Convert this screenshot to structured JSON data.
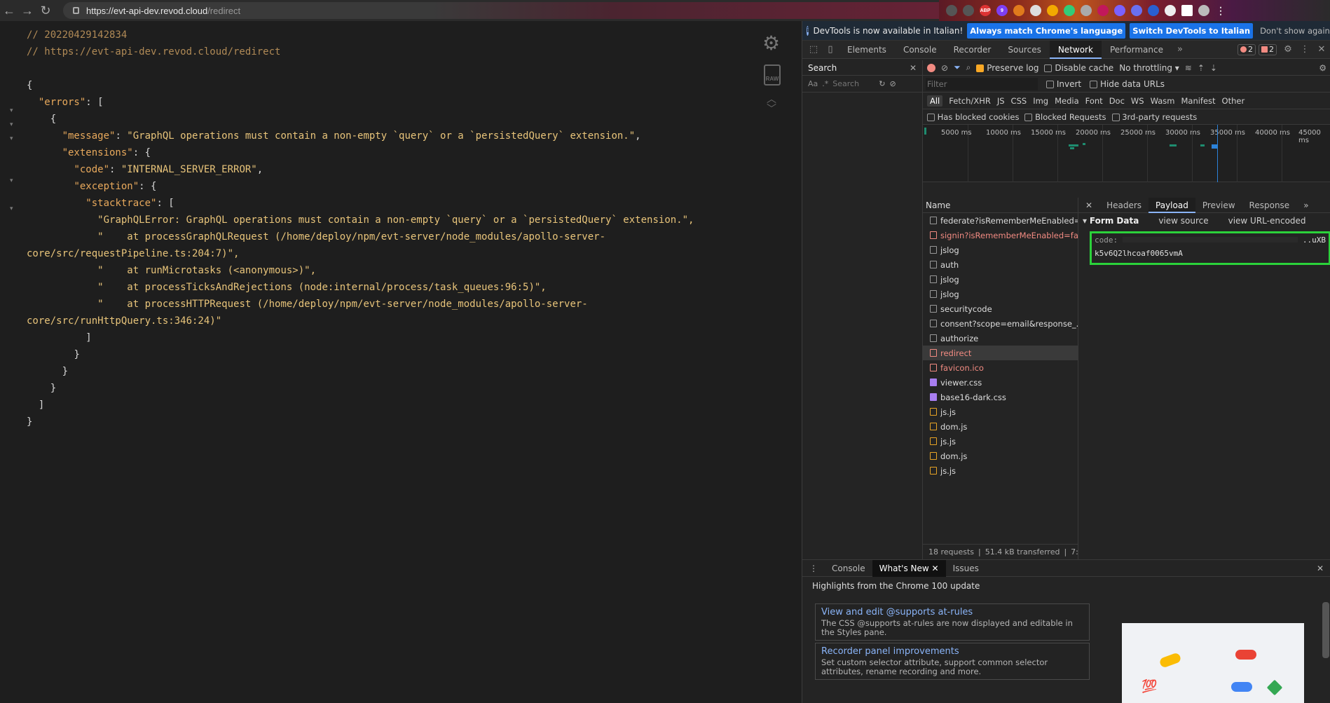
{
  "browser": {
    "url_host": "https://evt-api-dev.revod.cloud",
    "url_path": "/redirect",
    "extensions": [
      "ABP",
      "9"
    ]
  },
  "viewer": {
    "comment1": "// 20220429142834",
    "comment2": "// https://evt-api-dev.revod.cloud/redirect",
    "json": {
      "errors_key": "\"errors\"",
      "message_key": "\"message\"",
      "message_value": "\"GraphQL operations must contain a non-empty `query` or a `persistedQuery` extension.\"",
      "extensions_key": "\"extensions\"",
      "code_key": "\"code\"",
      "code_value": "\"INTERNAL_SERVER_ERROR\"",
      "exception_key": "\"exception\"",
      "stacktrace_key": "\"stacktrace\"",
      "stack": [
        "\"GraphQLError: GraphQL operations must contain a non-empty `query` or a `persistedQuery` extension.\",",
        "\"    at processGraphQLRequest (/home/deploy/npm/evt-server/node_modules/apollo-server-",
        "core/src/requestPipeline.ts:204:7)\",",
        "\"    at runMicrotasks (<anonymous>)\",",
        "\"    at processTicksAndRejections (node:internal/process/task_queues:96:5)\",",
        "\"    at processHTTPRequest (/home/deploy/npm/evt-server/node_modules/apollo-server-",
        "core/src/runHttpQuery.ts:346:24)\""
      ]
    },
    "raw_label": "RAW"
  },
  "devtools": {
    "infobar": {
      "message": "DevTools is now available in Italian!",
      "btn_match": "Always match Chrome's language",
      "btn_switch": "Switch DevTools to Italian",
      "btn_dismiss": "Don't show again"
    },
    "tabs": [
      "Elements",
      "Console",
      "Recorder",
      "Sources",
      "Network",
      "Performance"
    ],
    "active_tab": "Network",
    "errors_count": "2",
    "issues_count": "2",
    "search": {
      "title": "Search",
      "aa": "Aa",
      "regex": ".*",
      "placeholder": "Search"
    },
    "network": {
      "preserve_log": "Preserve log",
      "disable_cache": "Disable cache",
      "throttling": "No throttling",
      "filter_placeholder": "Filter",
      "invert": "Invert",
      "hide_data_urls": "Hide data URLs",
      "types": [
        "All",
        "Fetch/XHR",
        "JS",
        "CSS",
        "Img",
        "Media",
        "Font",
        "Doc",
        "WS",
        "Wasm",
        "Manifest",
        "Other"
      ],
      "has_blocked_cookies": "Has blocked cookies",
      "blocked_requests": "Blocked Requests",
      "third_party": "3rd-party requests",
      "ticks": [
        "5000 ms",
        "10000 ms",
        "15000 ms",
        "20000 ms",
        "25000 ms",
        "30000 ms",
        "35000 ms",
        "40000 ms",
        "45000 ms"
      ],
      "name_header": "Name",
      "requests": [
        {
          "name": "federate?isRememberMeEnabled=fa...",
          "kind": "doc",
          "status": "normal"
        },
        {
          "name": "signin?isRememberMeEnabled=fa...",
          "kind": "doc",
          "status": "error"
        },
        {
          "name": "jslog",
          "kind": "doc",
          "status": "normal"
        },
        {
          "name": "auth",
          "kind": "doc",
          "status": "normal"
        },
        {
          "name": "jslog",
          "kind": "doc",
          "status": "normal"
        },
        {
          "name": "jslog",
          "kind": "doc",
          "status": "normal"
        },
        {
          "name": "securitycode",
          "kind": "doc",
          "status": "normal"
        },
        {
          "name": "consent?scope=email&response_...",
          "kind": "doc",
          "status": "normal"
        },
        {
          "name": "authorize",
          "kind": "doc",
          "status": "normal"
        },
        {
          "name": "redirect",
          "kind": "doc",
          "status": "error-selected"
        },
        {
          "name": "favicon.ico",
          "kind": "doc",
          "status": "error"
        },
        {
          "name": "viewer.css",
          "kind": "css",
          "status": "normal"
        },
        {
          "name": "base16-dark.css",
          "kind": "css",
          "status": "normal"
        },
        {
          "name": "js.js",
          "kind": "js",
          "status": "normal"
        },
        {
          "name": "dom.js",
          "kind": "js",
          "status": "normal"
        },
        {
          "name": "js.js",
          "kind": "js",
          "status": "normal"
        },
        {
          "name": "dom.js",
          "kind": "js",
          "status": "normal"
        },
        {
          "name": "js.js",
          "kind": "js",
          "status": "normal"
        }
      ],
      "footer_requests": "18 requests",
      "footer_transferred": "51.4 kB transferred",
      "footer_more": "7:",
      "detail_tabs": [
        "Headers",
        "Payload",
        "Preview",
        "Response"
      ],
      "active_detail_tab": "Payload",
      "form_data_label": "Form Data",
      "view_source": "view source",
      "view_url_encoded": "view URL-encoded",
      "code_key": "code:",
      "code_tail": "..uXB",
      "code_line2": "k5v6Q2lhcoaf0065vmA"
    },
    "drawer": {
      "tabs": [
        "Console",
        "What's New",
        "Issues"
      ],
      "active_tab": "What's New",
      "highlight": "Highlights from the Chrome 100 update",
      "cards": [
        {
          "title": "View and edit @supports at-rules",
          "desc": "The CSS @supports at-rules are now displayed and editable in the Styles pane."
        },
        {
          "title": "Recorder panel improvements",
          "desc": "Set custom selector attribute, support common selector attributes, rename recording and more."
        }
      ]
    }
  }
}
